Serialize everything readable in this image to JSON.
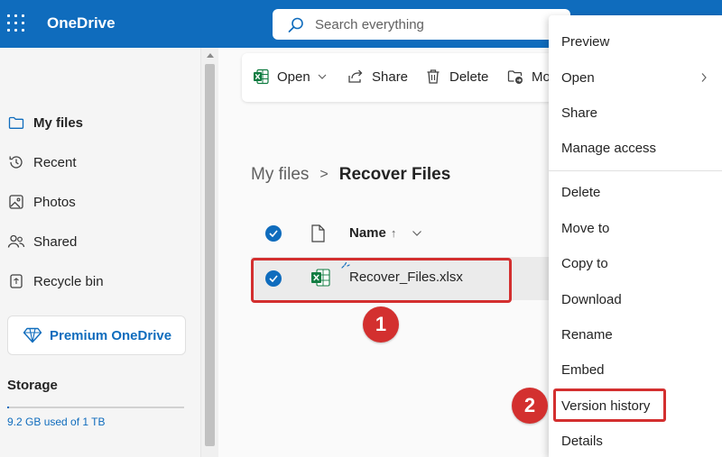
{
  "app": {
    "title": "OneDrive"
  },
  "search": {
    "placeholder": "Search everything"
  },
  "sidebar": {
    "items": [
      {
        "label": "My files",
        "icon": "folder-icon",
        "active": true
      },
      {
        "label": "Recent",
        "icon": "clock-history-icon"
      },
      {
        "label": "Photos",
        "icon": "image-icon"
      },
      {
        "label": "Shared",
        "icon": "people-icon"
      },
      {
        "label": "Recycle bin",
        "icon": "recycle-bin-icon"
      }
    ],
    "premium_label": "Premium OneDrive",
    "storage": {
      "title": "Storage",
      "usage_text": "9.2 GB used of 1 TB",
      "used_fraction": 0.009
    }
  },
  "toolbar": {
    "open_label": "Open",
    "share_label": "Share",
    "delete_label": "Delete",
    "move_label": "Mo"
  },
  "breadcrumb": {
    "root": "My files",
    "separator": ">",
    "current": "Recover Files"
  },
  "file_list": {
    "header_name": "Name",
    "sort_indicator": "↑",
    "rows": [
      {
        "name": "Recover_Files.xlsx",
        "type": "excel-file-icon",
        "selected": true
      }
    ]
  },
  "context_menu": {
    "group1": [
      "Preview",
      "Open",
      "Share",
      "Manage access"
    ],
    "group2": [
      "Delete",
      "Move to",
      "Copy to",
      "Download",
      "Rename",
      "Embed",
      "Version history",
      "Details"
    ]
  },
  "annotations": {
    "step1": "1",
    "step2": "2"
  },
  "colors": {
    "brand": "#0f6cbd",
    "highlight": "#d32f2f",
    "excel": "#107c41"
  }
}
